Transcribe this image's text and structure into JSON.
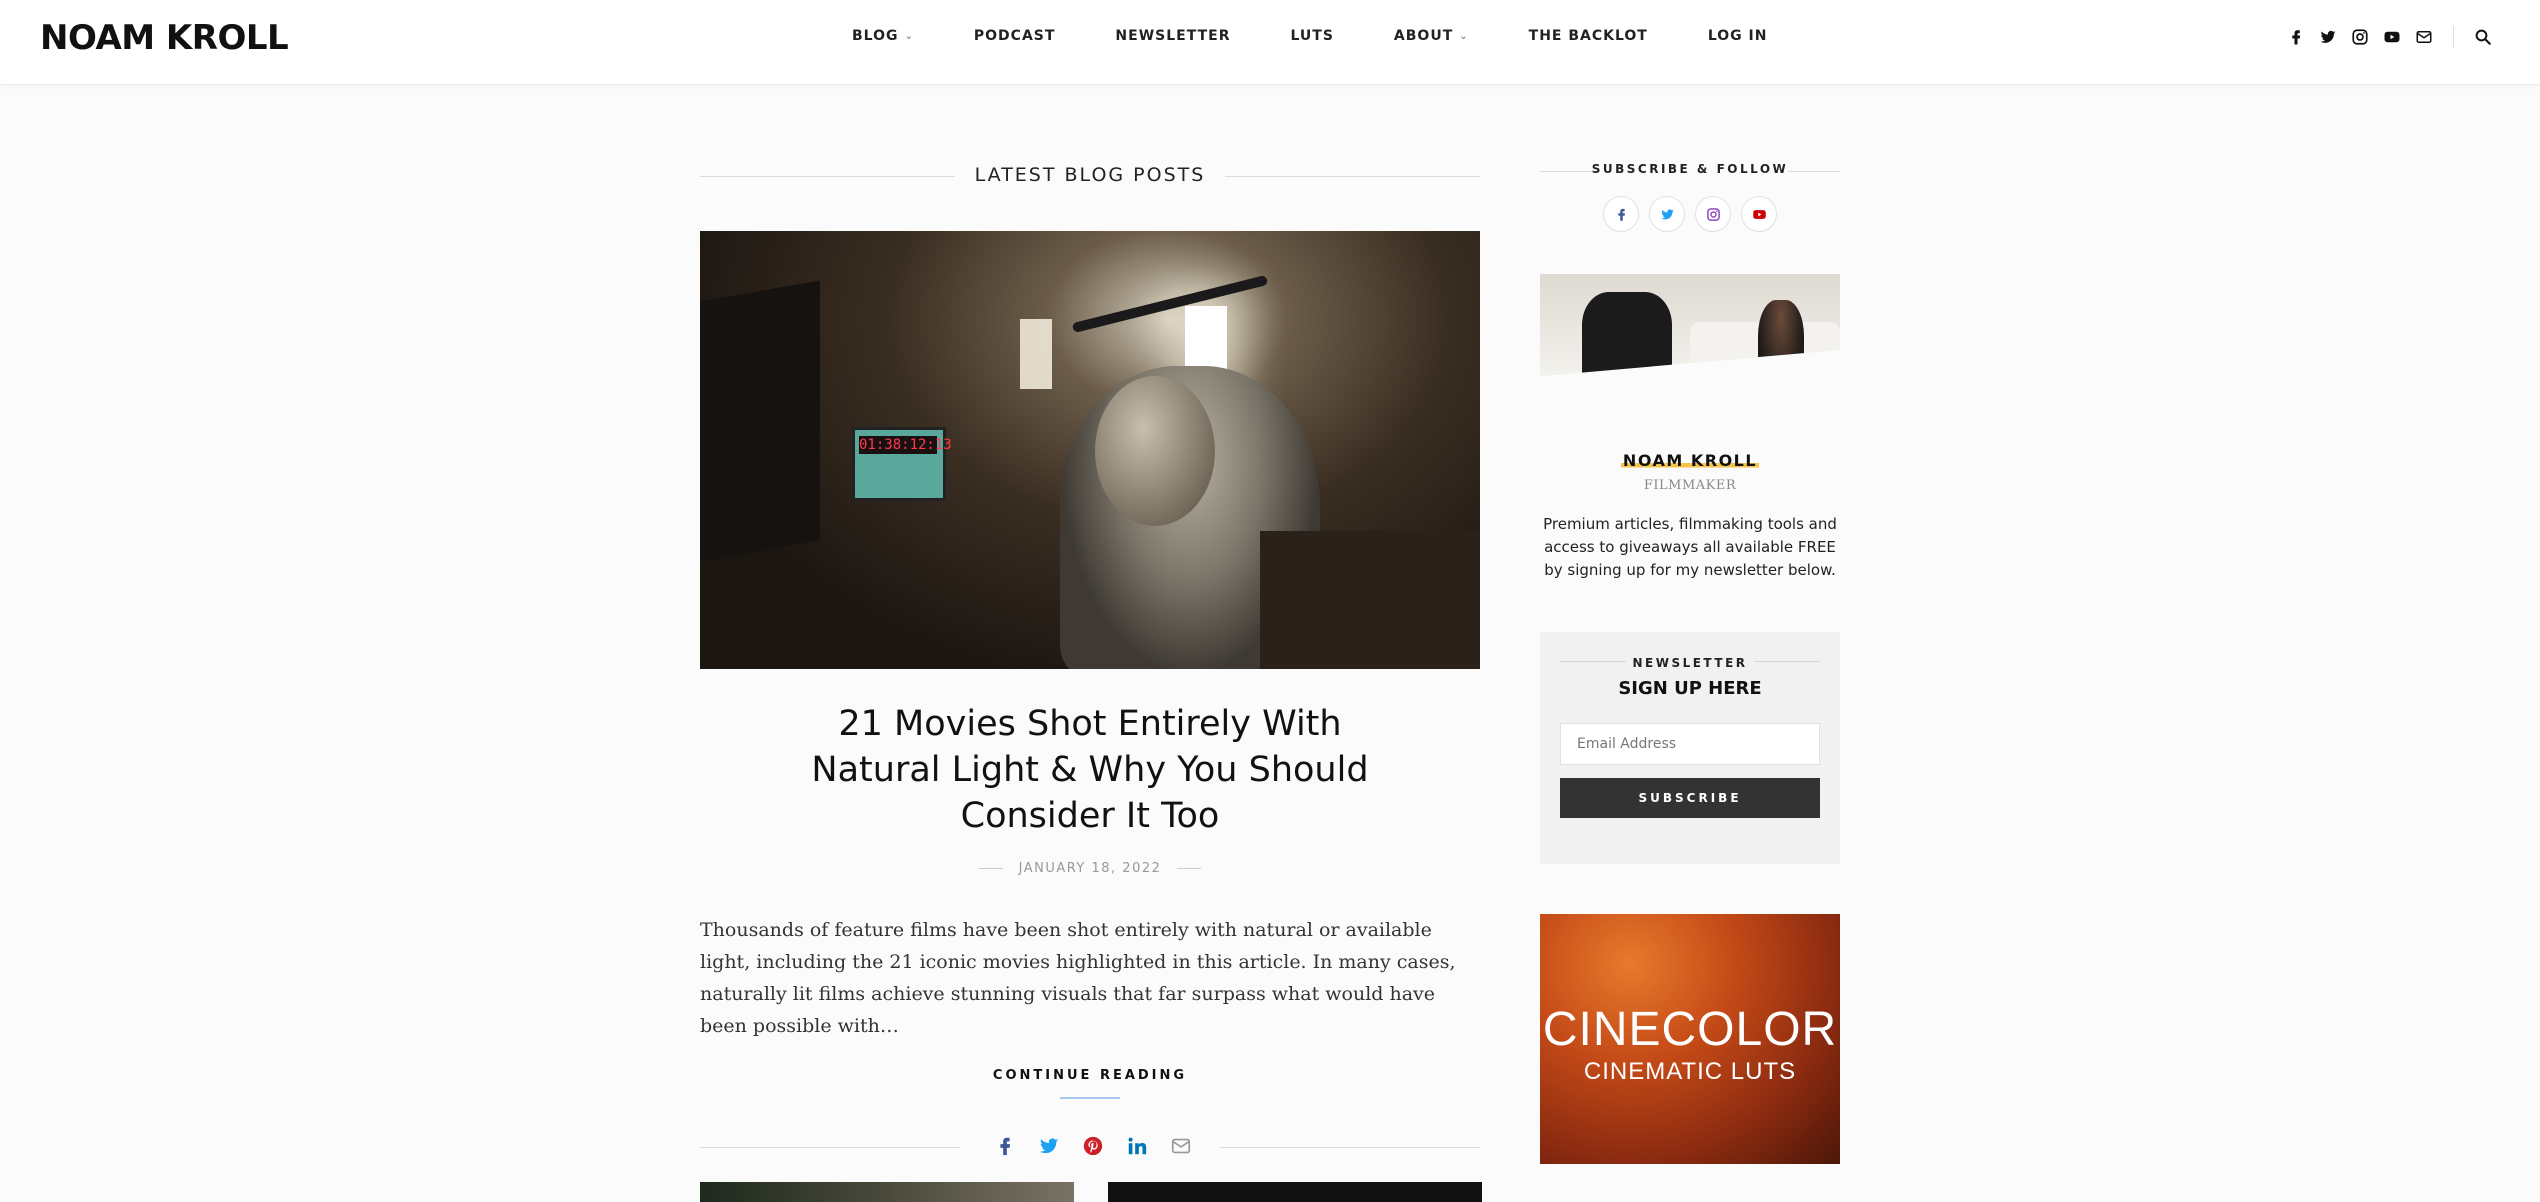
{
  "header": {
    "logo": "NOAM KROLL",
    "nav": [
      {
        "label": "BLOG",
        "has_dropdown": true
      },
      {
        "label": "PODCAST",
        "has_dropdown": false
      },
      {
        "label": "NEWSLETTER",
        "has_dropdown": false
      },
      {
        "label": "LUTS",
        "has_dropdown": false
      },
      {
        "label": "ABOUT",
        "has_dropdown": true
      },
      {
        "label": "THE BACKLOT",
        "has_dropdown": false
      },
      {
        "label": "LOG IN",
        "has_dropdown": false
      }
    ],
    "icons": [
      "facebook-icon",
      "twitter-icon",
      "instagram-icon",
      "youtube-icon",
      "mail-icon",
      "search-icon"
    ]
  },
  "main": {
    "section_title": "LATEST BLOG POSTS",
    "post": {
      "title": "21 Movies Shot Entirely With Natural Light & Why You Should Consider It Too",
      "date": "JANUARY 18, 2022",
      "excerpt": "Thousands of feature films have been shot entirely with natural or available light, including the 21 iconic movies highlighted in this article. In many cases, naturally lit films achieve stunning visuals that far surpass what would have been possible with…",
      "continue_label": "CONTINUE READING",
      "slate_text": "01:38:12:13",
      "share_icons": [
        "facebook-icon",
        "twitter-icon",
        "pinterest-icon",
        "linkedin-icon",
        "mail-icon"
      ]
    }
  },
  "sidebar": {
    "subscribe_heading": "SUBSCRIBE & FOLLOW",
    "social": [
      "facebook-icon",
      "twitter-icon",
      "instagram-icon",
      "youtube-icon"
    ],
    "about": {
      "name": "NOAM KROLL",
      "role": "FILMMAKER",
      "text": "Premium articles, filmmaking tools and access to giveaways all available FREE by signing up for my newsletter below."
    },
    "newsletter": {
      "heading": "NEWSLETTER",
      "subheading": "SIGN UP HERE",
      "email_placeholder": "Email Address",
      "button_label": "SUBSCRIBE"
    },
    "ad": {
      "title": "CINECOLOR",
      "subtitle": "CINEMATIC LUTS"
    }
  },
  "colors": {
    "facebook": "#3b5998",
    "twitter": "#1da1f2",
    "instagram": "#8a3ab9",
    "youtube": "#cc0000",
    "pinterest": "#cb2027",
    "linkedin": "#0077b5",
    "highlight": "#f5c24a",
    "button_dark": "#333333"
  }
}
